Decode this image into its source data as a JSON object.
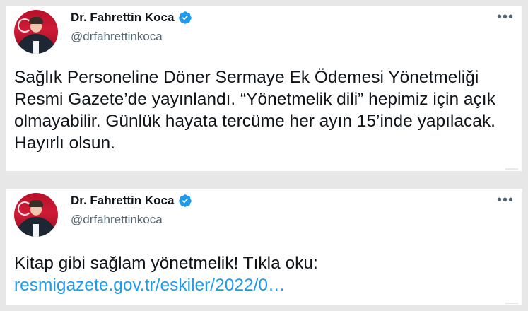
{
  "colors": {
    "background": "#e7e7e7",
    "card": "#ffffff",
    "text": "#0f1419",
    "secondary_text": "#536471",
    "link": "#1d9bf0",
    "verified_badge": "#1d9bf0"
  },
  "tweets": [
    {
      "author": {
        "name": "Dr. Fahrettin Koca",
        "handle": "@drfahrettinkoca",
        "verified_icon": "verified-badge-icon",
        "avatar_icon": "profile-photo"
      },
      "more_icon": "more-options-icon",
      "more_label": "•••",
      "text": "Sağlık Personeline Döner Sermaye Ek Ödemesi Yönetmeliği Resmi Gazete’de yayınlandı. “Yönetmelik dili” hepimiz için açık olmayabilir. Günlük hayata tercüme her ayın 15’inde yapılacak. Hayırlı olsun."
    },
    {
      "author": {
        "name": "Dr. Fahrettin Koca",
        "handle": "@drfahrettinkoca",
        "verified_icon": "verified-badge-icon",
        "avatar_icon": "profile-photo"
      },
      "more_icon": "more-options-icon",
      "more_label": "•••",
      "text": "Kitap gibi sağlam yönetmelik! Tıkla oku:",
      "link": "resmigazete.gov.tr/eskiler/2022/0…"
    }
  ]
}
